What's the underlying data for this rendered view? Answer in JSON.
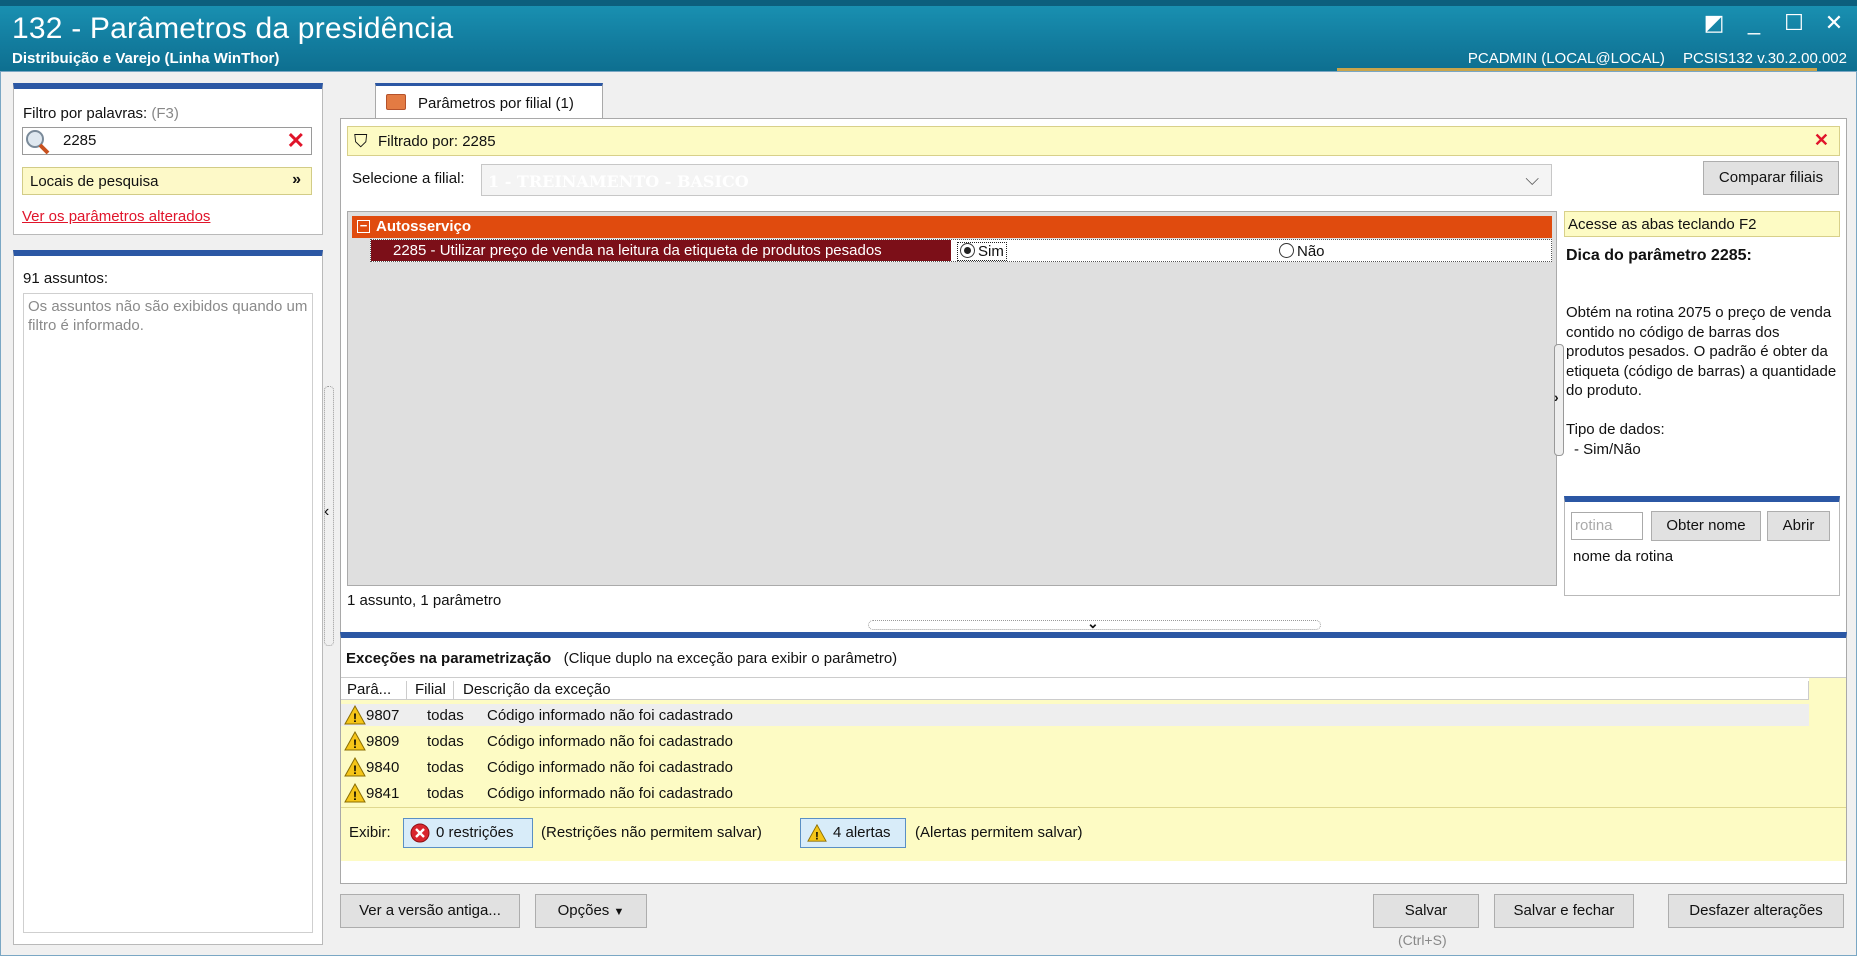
{
  "window": {
    "title": "132 - Parâmetros da presidência",
    "subtitle": "Distribuição e Varejo (Linha WinThor)",
    "user": "PCADMIN (LOCAL@LOCAL)",
    "version": "PCSIS132  v.30.2.00.002"
  },
  "filter": {
    "label": "Filtro por palavras:",
    "hint": "(F3)",
    "value": "2285",
    "locais": "Locais de pesquisa",
    "changed_link": "Ver os parâmetros alterados"
  },
  "assuntos": {
    "count_label": "91 assuntos:",
    "note": "Os assuntos não são exibidos quando um filtro é informado."
  },
  "tab": {
    "label": "Parâmetros por filial  (1)"
  },
  "filterbar": {
    "text": "Filtrado por: 2285"
  },
  "filial": {
    "label": "Selecione a filial:",
    "selected": "1 - TREINAMENTO - BASICO",
    "compare_button": "Comparar filiais"
  },
  "grid": {
    "group": "Autosserviço",
    "param": "2285 - Utilizar preço de venda na leitura da etiqueta de produtos pesados",
    "opt_sim": "Sim",
    "opt_nao": "Não",
    "selected": "Sim",
    "footer": "1 assunto, 1 parâmetro"
  },
  "tip": {
    "f2": "Acesse as abas teclando F2",
    "title": "Dica do parâmetro 2285:",
    "text": "Obtém na rotina 2075 o preço de venda contido no código de barras dos produtos pesados. O padrão é obter da etiqueta (código de barras) a quantidade do produto.",
    "tipo_label": "Tipo de dados:",
    "tipo_value": "- Sim/Não",
    "rotina_placeholder": "rotina",
    "obter_button": "Obter nome",
    "abrir_button": "Abrir",
    "rotina_hint": "nome da rotina"
  },
  "exceptions": {
    "title": "Exceções na parametrização",
    "subtitle": "(Clique duplo na exceção para exibir o parâmetro)",
    "columns": [
      "Parâ...",
      "Filial",
      "Descrição da exceção"
    ],
    "rows": [
      {
        "param": "9807",
        "filial": "todas",
        "desc": "Código informado não foi cadastrado"
      },
      {
        "param": "9809",
        "filial": "todas",
        "desc": "Código informado não foi cadastrado"
      },
      {
        "param": "9840",
        "filial": "todas",
        "desc": "Código informado não foi cadastrado"
      },
      {
        "param": "9841",
        "filial": "todas",
        "desc": "Código informado não foi cadastrado"
      }
    ],
    "exibir": "Exibir:",
    "restricoes": "0 restrições",
    "restricoes_note": "(Restrições não permitem salvar)",
    "alertas": "4 alertas",
    "alertas_note": "(Alertas permitem salvar)"
  },
  "buttons": {
    "ver_antiga": "Ver a versão antiga...",
    "opcoes": "Opções",
    "salvar": "Salvar",
    "salvar_shortcut": "(Ctrl+S)",
    "salvar_fechar": "Salvar e fechar",
    "desfazer": "Desfazer alterações"
  },
  "colors": {
    "titlebar": "#137ea0",
    "group_header": "#e04b0e",
    "param_row": "#7c0f18",
    "accent_blue": "#2b57a4",
    "highlight_yellow": "#fdfbc4",
    "error_red": "#e0142a"
  }
}
